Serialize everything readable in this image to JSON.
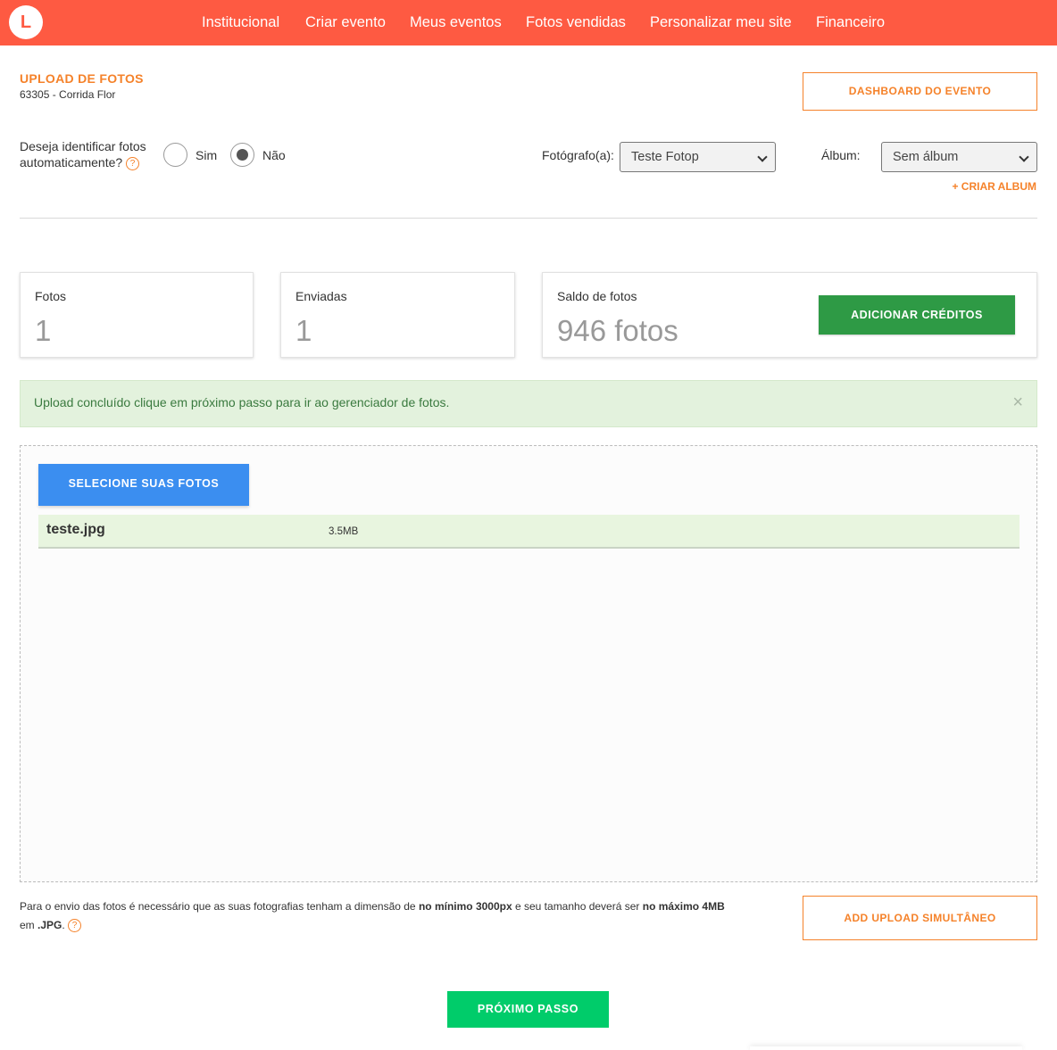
{
  "nav": {
    "logo_letter": "L",
    "items": [
      "Institucional",
      "Criar evento",
      "Meus eventos",
      "Fotos vendidas",
      "Personalizar meu site",
      "Financeiro"
    ]
  },
  "header": {
    "title": "UPLOAD DE FOTOS",
    "subtitle": "63305 - Corrida Flor",
    "dashboard_button": "DASHBOARD DO EVENTO"
  },
  "identify": {
    "question_line1": "Deseja identificar fotos",
    "question_line2": "automaticamente?",
    "help_glyph": "?",
    "options": [
      "Sim",
      "Não"
    ],
    "selected": "Não"
  },
  "photographer": {
    "label": "Fotógrafo(a):",
    "value": "Teste Fotop"
  },
  "album": {
    "label": "Álbum:",
    "value": "Sem álbum",
    "create_link": "+ CRIAR ALBUM"
  },
  "stats": {
    "photos": {
      "label": "Fotos",
      "value": "1"
    },
    "sent": {
      "label": "Enviadas",
      "value": "1"
    },
    "balance": {
      "label": "Saldo de fotos",
      "value": "946 fotos",
      "button": "ADICIONAR CRÉDITOS"
    }
  },
  "alert": {
    "text": "Upload concluído clique em próximo passo para ir ao gerenciador de fotos.",
    "close": "×"
  },
  "upload": {
    "select_button": "SELECIONE SUAS FOTOS",
    "files": [
      {
        "name": "teste.jpg",
        "size": "3.5MB"
      }
    ]
  },
  "footnote": {
    "part1": "Para o envio das fotos é necessário que as suas fotografias tenham a dimensão de ",
    "bold1": "no mínimo 3000px",
    "part2": " e seu tamanho deverá ser ",
    "bold2": "no máximo 4MB",
    "part3": "em ",
    "bold3": ".JPG",
    "part4": ".",
    "help_glyph": "?"
  },
  "buttons": {
    "simultaneous": "ADD UPLOAD SIMULTÂNEO",
    "next": "PRÓXIMO PASSO"
  },
  "colors": {
    "nav_bg": "#fe5a42",
    "accent_orange": "#f5822a",
    "credits_green": "#2e9a45",
    "select_blue": "#3b8ef0",
    "next_green": "#00cc6a",
    "alert_bg": "#e3f2dd"
  }
}
